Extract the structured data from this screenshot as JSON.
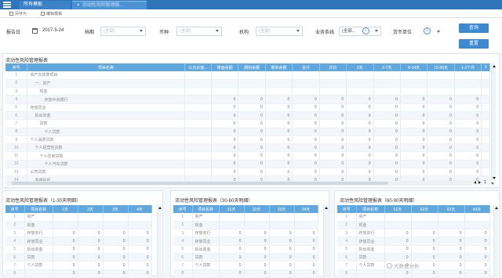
{
  "tabs": [
    {
      "label": "所有模板",
      "close": ""
    },
    {
      "label": "流动性风险管理报...",
      "close": "×"
    }
  ],
  "toolbar": {
    "btn1": "另存为",
    "btn2": "编辑模板"
  },
  "filters": {
    "report_date_label": "报告日",
    "report_date_value": "2017-5-24",
    "field2_label": "档期",
    "field2_value": "(全部)",
    "currency_label": "币种",
    "currency_value": "(全部)",
    "org_label": "机构",
    "org_value": "(全部)",
    "biz_label": "业务条线",
    "biz_value": "(全部...",
    "unit_label": "货币单位",
    "unit_value": "1",
    "query_btn": "查询",
    "reset_btn": "重置"
  },
  "main_panel": {
    "title": "流动性风险管理报表",
    "headers": [
      "序号",
      "项目名称",
      "公允价值...",
      "账面余额",
      "期初余额",
      "期末余额",
      "合计",
      "次日",
      "2天",
      "2-7天",
      "8-14天",
      "15-30天",
      "1-2个月",
      "3"
    ],
    "rows": [
      [
        "1",
        "资产负债表项目",
        "",
        "",
        "",
        "",
        "",
        "",
        "",
        "",
        "",
        "",
        "",
        ""
      ],
      [
        "2",
        "一、资产",
        "",
        "",
        "",
        "",
        "",
        "",
        "",
        "",
        "",
        "",
        "",
        ""
      ],
      [
        "3",
        "现金",
        "",
        "",
        "",
        "",
        "",
        "",
        "",
        "",
        "",
        "",
        "",
        ""
      ],
      [
        "4",
        "存放中央银行",
        "",
        "0",
        "0",
        "0",
        "0",
        "0",
        "0",
        "0",
        "0",
        "0",
        "0",
        ""
      ],
      [
        "5",
        "存放同业",
        "",
        "0",
        "0",
        "0",
        "0",
        "0",
        "0",
        "0",
        "0",
        "0",
        "0",
        ""
      ],
      [
        "6",
        "拆出资金",
        "",
        "0",
        "0",
        "0",
        "0",
        "0",
        "0",
        "0",
        "0",
        "0",
        "0",
        ""
      ],
      [
        "7",
        "贷款",
        "",
        "0",
        "0",
        "0",
        "0",
        "0",
        "0",
        "0",
        "0",
        "0",
        "0",
        ""
      ],
      [
        "8",
        "个人贷款",
        "",
        "0",
        "0",
        "0",
        "0",
        "0",
        "0",
        "0",
        "0",
        "0",
        "0",
        ""
      ],
      [
        "9",
        "个人消费贷款",
        "",
        "0",
        "0",
        "0",
        "0",
        "0",
        "0",
        "0",
        "0",
        "0",
        "0",
        ""
      ],
      [
        "10",
        "个人经营性贷款",
        "",
        "0",
        "0",
        "0",
        "0",
        "0",
        "0",
        "0",
        "0",
        "0",
        "0",
        ""
      ],
      [
        "11",
        "个人住房贷款",
        "",
        "0",
        "0",
        "0",
        "0",
        "0",
        "0",
        "0",
        "0",
        "0",
        "0",
        ""
      ],
      [
        "12",
        "个人汽车贷款",
        "",
        "0",
        "0",
        "0",
        "0",
        "0",
        "0",
        "0",
        "0",
        "0",
        "0",
        ""
      ],
      [
        "13",
        "公司贷款",
        "",
        "0",
        "0",
        "0",
        "0",
        "0",
        "0",
        "0",
        "0",
        "0",
        "0",
        ""
      ],
      [
        "14",
        "票据贴现",
        "",
        "0",
        "0",
        "0",
        "0",
        "0",
        "0",
        "0",
        "0",
        "0",
        "0",
        ""
      ]
    ],
    "pager_value": "1"
  },
  "sub_panels": [
    {
      "title": "流动性风险管理报表（1-30天明细）",
      "headers": [
        "序号",
        "项目名称",
        "1天",
        "2天",
        "3天",
        "4天"
      ],
      "rows": [
        [
          "1",
          "资产",
          "",
          "",
          "",
          ""
        ],
        [
          "2",
          "现金",
          "",
          "",
          "",
          ""
        ],
        [
          "3",
          "存放央行",
          "0",
          "0",
          "0",
          "0"
        ],
        [
          "4",
          "存放同业",
          "0",
          "0",
          "0",
          "0"
        ],
        [
          "5",
          "拆出资金",
          "0",
          "0",
          "0",
          "0"
        ],
        [
          "6",
          "贷款",
          "0",
          "0",
          "0",
          "0"
        ],
        [
          "7",
          "个人贷款",
          "0",
          "0",
          "0",
          "0"
        ],
        [
          "8",
          "",
          "0",
          "0",
          "0",
          "0"
        ]
      ]
    },
    {
      "title": "流动性风险管理报表（30-60天明细）",
      "headers": [
        "序号",
        "项目名称",
        "31天",
        "32天",
        "33天",
        "34天"
      ],
      "rows": [
        [
          "1",
          "资产",
          "",
          "",
          "",
          ""
        ],
        [
          "2",
          "现金",
          "",
          "",
          "",
          ""
        ],
        [
          "3",
          "存放央行",
          "0",
          "0",
          "0",
          "0"
        ],
        [
          "4",
          "存放同业",
          "0",
          "0",
          "0",
          "0"
        ],
        [
          "5",
          "拆出资金",
          "0",
          "0",
          "0",
          "0"
        ],
        [
          "6",
          "贷款",
          "0",
          "0",
          "0",
          "0"
        ],
        [
          "7",
          "个人贷款",
          "0",
          "0",
          "0",
          "0"
        ],
        [
          "8",
          "",
          "0",
          "0",
          "0",
          "0"
        ]
      ]
    },
    {
      "title": "流动性风险管理报表（60-90天明细）",
      "headers": [
        "序号",
        "项目名称",
        "61天",
        "62天",
        "63天",
        "64天"
      ],
      "rows": [
        [
          "1",
          "资产",
          "",
          "",
          "",
          ""
        ],
        [
          "2",
          "现金",
          "",
          "",
          "",
          ""
        ],
        [
          "3",
          "存放央行",
          "0",
          "0",
          "0",
          "0"
        ],
        [
          "4",
          "存放同业",
          "0",
          "0",
          "0",
          "0"
        ],
        [
          "5",
          "拆出资金",
          "0",
          "0",
          "0",
          "0"
        ],
        [
          "6",
          "贷款",
          "0",
          "0",
          "0",
          "0"
        ],
        [
          "7",
          "个人贷款",
          "0",
          "0",
          "0",
          "0"
        ],
        [
          "8",
          "",
          "0",
          "0",
          "0",
          "0"
        ]
      ]
    }
  ],
  "watermark": "大数据分析"
}
